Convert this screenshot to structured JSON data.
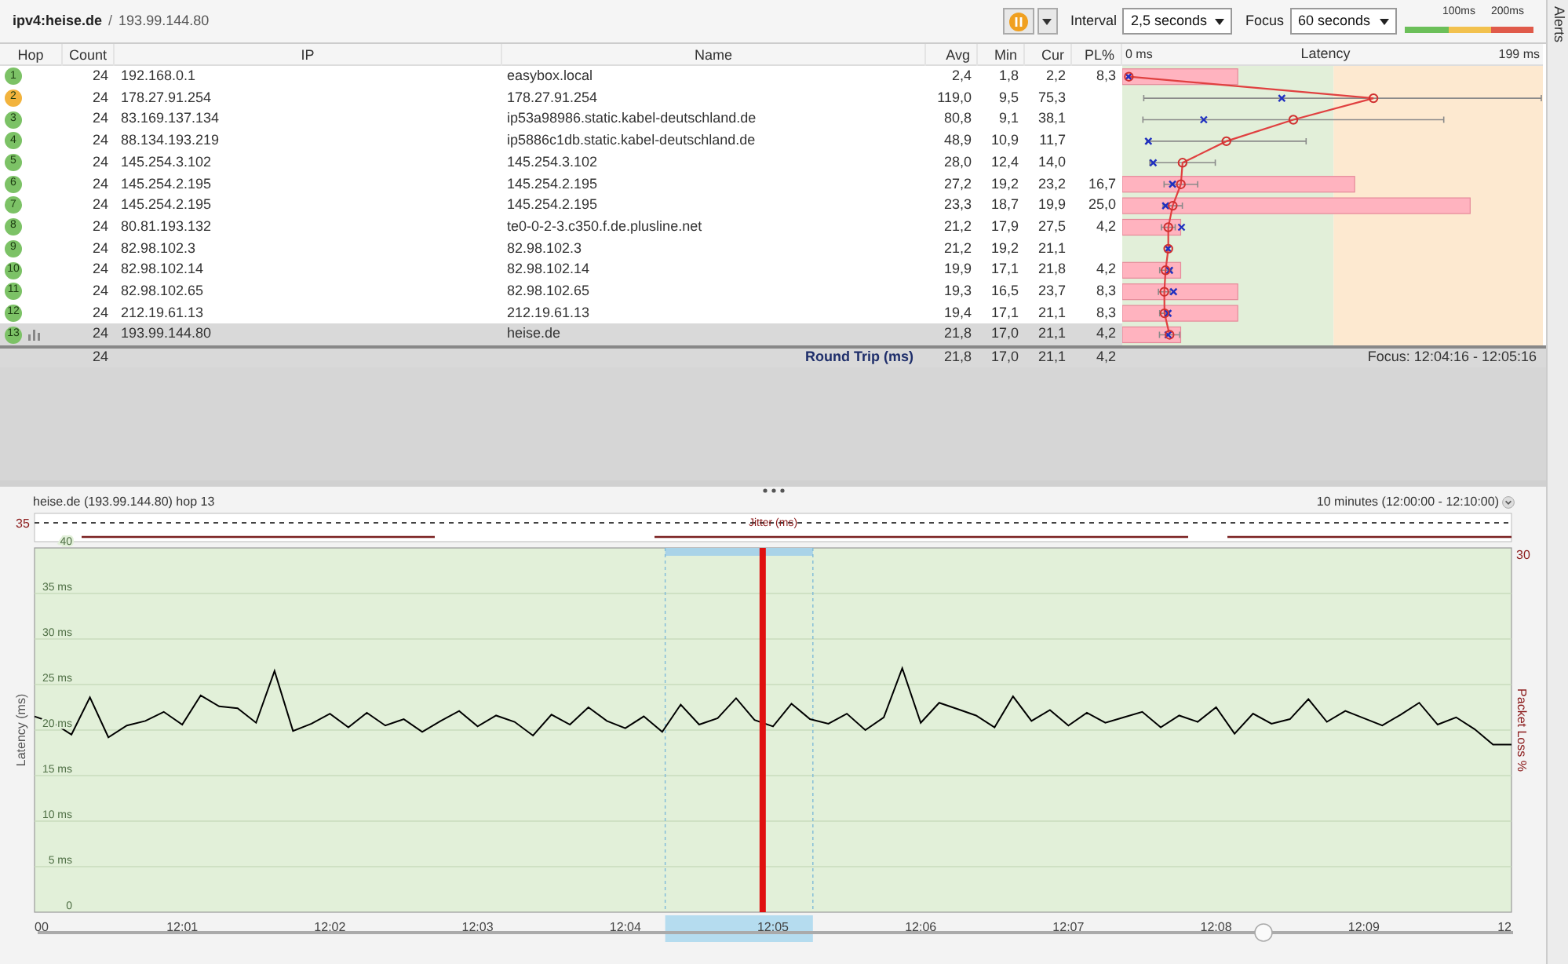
{
  "header": {
    "target": "ipv4:heise.de",
    "separator": "/",
    "ip": "193.99.144.80"
  },
  "toolbar": {
    "interval": {
      "label": "Interval",
      "value": "2,5 seconds"
    },
    "focus": {
      "label": "Focus",
      "value": "60 seconds"
    },
    "legend": [
      "100ms",
      "200ms"
    ]
  },
  "side_tab": "Alerts",
  "table": {
    "columns": [
      "Hop",
      "Count",
      "IP",
      "Name",
      "Avg",
      "Min",
      "Cur",
      "PL%"
    ],
    "latency": {
      "title": "Latency",
      "min_label": "0 ms",
      "max_label": "199 ms"
    },
    "rows": [
      {
        "hop": "1",
        "color": "#7cc266",
        "count": "24",
        "ip": "192.168.0.1",
        "name": "easybox.local",
        "avg": "2,4",
        "min": "1,8",
        "cur": "2,2",
        "pl": "8,3",
        "selected": false
      },
      {
        "hop": "2",
        "color": "#f2b33d",
        "count": "24",
        "ip": "178.27.91.254",
        "name": "178.27.91.254",
        "avg": "119,0",
        "min": "9,5",
        "cur": "75,3",
        "selected": false
      },
      {
        "hop": "3",
        "color": "#7cc266",
        "count": "24",
        "ip": "83.169.137.134",
        "name": "ip53a98986.static.kabel-deutschland.de",
        "avg": "80,8",
        "min": "9,1",
        "cur": "38,1",
        "selected": false
      },
      {
        "hop": "4",
        "color": "#7cc266",
        "count": "24",
        "ip": "88.134.193.219",
        "name": "ip5886c1db.static.kabel-deutschland.de",
        "avg": "48,9",
        "min": "10,9",
        "cur": "11,7",
        "selected": false
      },
      {
        "hop": "5",
        "color": "#7cc266",
        "count": "24",
        "ip": "145.254.3.102",
        "name": "145.254.3.102",
        "avg": "28,0",
        "min": "12,4",
        "cur": "14,0",
        "selected": false
      },
      {
        "hop": "6",
        "color": "#7cc266",
        "count": "24",
        "ip": "145.254.2.195",
        "name": "145.254.2.195",
        "avg": "27,2",
        "min": "19,2",
        "cur": "23,2",
        "pl": "16,7",
        "selected": false
      },
      {
        "hop": "7",
        "color": "#7cc266",
        "count": "24",
        "ip": "145.254.2.195",
        "name": "145.254.2.195",
        "avg": "23,3",
        "min": "18,7",
        "cur": "19,9",
        "pl": "25,0",
        "selected": false
      },
      {
        "hop": "8",
        "color": "#7cc266",
        "count": "24",
        "ip": "80.81.193.132",
        "name": "te0-0-2-3.c350.f.de.plusline.net",
        "avg": "21,2",
        "min": "17,9",
        "cur": "27,5",
        "pl": "4,2",
        "selected": false
      },
      {
        "hop": "9",
        "color": "#7cc266",
        "count": "24",
        "ip": "82.98.102.3",
        "name": "82.98.102.3",
        "avg": "21,2",
        "min": "19,2",
        "cur": "21,1",
        "selected": false
      },
      {
        "hop": "10",
        "color": "#7cc266",
        "count": "24",
        "ip": "82.98.102.14",
        "name": "82.98.102.14",
        "avg": "19,9",
        "min": "17,1",
        "cur": "21,8",
        "pl": "4,2",
        "selected": false
      },
      {
        "hop": "11",
        "color": "#7cc266",
        "count": "24",
        "ip": "82.98.102.65",
        "name": "82.98.102.65",
        "avg": "19,3",
        "min": "16,5",
        "cur": "23,7",
        "pl": "8,3",
        "selected": false
      },
      {
        "hop": "12",
        "color": "#7cc266",
        "count": "24",
        "ip": "212.19.61.13",
        "name": "212.19.61.13",
        "avg": "19,4",
        "min": "17,1",
        "cur": "21,1",
        "pl": "8,3",
        "selected": false
      },
      {
        "hop": "13",
        "color": "#7cc266",
        "count": "24",
        "ip": "193.99.144.80",
        "name": "heise.de",
        "avg": "21,8",
        "min": "17,0",
        "cur": "21,1",
        "pl": "4,2",
        "selected": true
      }
    ],
    "summary": {
      "count": "24",
      "label": "Round Trip (ms)",
      "avg": "21,8",
      "min": "17,0",
      "cur": "21,1",
      "pl": "4,2",
      "focus": "Focus: 12:04:16 - 12:05:16"
    }
  },
  "graph": {
    "title": "heise.de (193.99.144.80) hop 13",
    "range": "10 minutes (12:00:00 - 12:10:00)",
    "jitter": {
      "label": "Jitter (ms)",
      "scale": "35"
    },
    "loss_axis": {
      "label": "Packet Loss %",
      "max": "30"
    },
    "chart_data": {
      "type": "line",
      "ylabel": "Latency (ms)",
      "ylim": [
        0,
        40
      ],
      "grid": true,
      "yticks": [
        {
          "value": 0,
          "label": "0"
        },
        {
          "value": 5,
          "label": "5 ms"
        },
        {
          "value": 10,
          "label": "10 ms"
        },
        {
          "value": 15,
          "label": "15 ms"
        },
        {
          "value": 20,
          "label": "20 ms"
        },
        {
          "value": 25,
          "label": "25 ms"
        },
        {
          "value": 30,
          "label": "30 ms"
        },
        {
          "value": 35,
          "label": "35 ms"
        },
        {
          "value": 40,
          "label": "40"
        }
      ],
      "categories": [
        "00",
        null,
        null,
        null,
        null,
        null,
        null,
        null,
        "12:01",
        null,
        null,
        null,
        null,
        null,
        null,
        null,
        "12:02",
        null,
        null,
        null,
        null,
        null,
        null,
        null,
        "12:03",
        null,
        null,
        null,
        null,
        null,
        null,
        null,
        "12:04",
        null,
        null,
        null,
        null,
        null,
        null,
        null,
        "12:05",
        null,
        null,
        null,
        null,
        null,
        null,
        null,
        "12:06",
        null,
        null,
        null,
        null,
        null,
        null,
        null,
        "12:07",
        null,
        null,
        null,
        null,
        null,
        null,
        null,
        "12:08",
        null,
        null,
        null,
        null,
        null,
        null,
        null,
        "12:09",
        null,
        null,
        null,
        null,
        null,
        null,
        null,
        "12"
      ],
      "series": [
        {
          "color": "#000000",
          "values": [
            21.5,
            20.8,
            19.5,
            23.6,
            19.2,
            20.5,
            21.0,
            22.0,
            20.6,
            23.8,
            22.6,
            22.4,
            20.8,
            26.5,
            19.9,
            20.7,
            21.8,
            20.3,
            21.9,
            20.5,
            21.2,
            19.8,
            21.0,
            22.1,
            20.4,
            21.6,
            20.9,
            19.4,
            21.7,
            20.6,
            22.5,
            21.0,
            20.2,
            21.5,
            19.8,
            22.8,
            20.6,
            21.3,
            23.5,
            21.1,
            20.4,
            22.9,
            21.2,
            20.7,
            21.8,
            20.0,
            21.4,
            26.8,
            20.8,
            23.0,
            22.3,
            21.6,
            20.3,
            23.7,
            21.0,
            22.2,
            20.5,
            21.9,
            20.8,
            21.4,
            22.0,
            20.3,
            21.6,
            20.9,
            22.5,
            19.6,
            21.8,
            20.7,
            21.2,
            23.4,
            20.9,
            22.1,
            21.3,
            20.5,
            21.7,
            23.0,
            20.6,
            21.4,
            20.1,
            18.4,
            18.4
          ]
        }
      ]
    }
  }
}
